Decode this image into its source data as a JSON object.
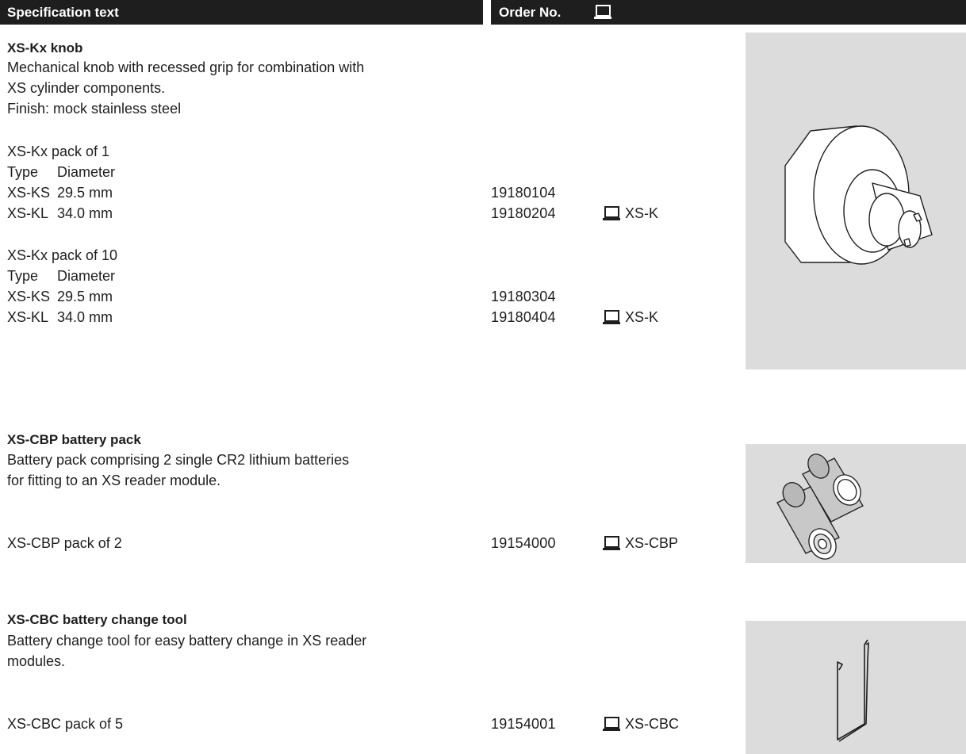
{
  "header": {
    "spec_label": "Specification text",
    "order_label": "Order No."
  },
  "products": [
    {
      "title": "XS-Kx knob",
      "description": [
        "Mechanical knob with recessed grip for combination with",
        "XS cylinder components.",
        "Finish: mock stainless steel"
      ],
      "groups": [
        {
          "label": "XS-Kx pack of 1",
          "col_type": "Type",
          "col_diameter": "Diameter",
          "rows": [
            {
              "type": "XS-KS",
              "diameter": "29.5 mm",
              "order_no": "19180104",
              "code": ""
            },
            {
              "type": "XS-KL",
              "diameter": "34.0 mm",
              "order_no": "19180204",
              "code": "XS-K"
            }
          ]
        },
        {
          "label": "XS-Kx pack of 10",
          "col_type": "Type",
          "col_diameter": "Diameter",
          "rows": [
            {
              "type": "XS-KS",
              "diameter": "29.5 mm",
              "order_no": "19180304",
              "code": ""
            },
            {
              "type": "XS-KL",
              "diameter": "34.0 mm",
              "order_no": "19180404",
              "code": "XS-K"
            }
          ]
        }
      ]
    },
    {
      "title": "XS-CBP battery pack",
      "description": [
        "Battery pack comprising 2 single CR2 lithium batteries",
        "for fitting to an XS reader module."
      ],
      "pack_label": "XS-CBP pack of 2",
      "order_no": "19154000",
      "code": "XS-CBP"
    },
    {
      "title": "XS-CBC battery change tool",
      "description": [
        "Battery change tool for easy battery change in XS reader",
        "modules."
      ],
      "pack_label": "XS-CBC pack of 5",
      "order_no": "19154001",
      "code": "XS-CBC"
    }
  ],
  "icons": {
    "computer": "computer-icon"
  },
  "colors": {
    "header_bg": "#1e1e1e",
    "panel_bg": "#dcdcdc",
    "text": "#1e1e1e"
  }
}
